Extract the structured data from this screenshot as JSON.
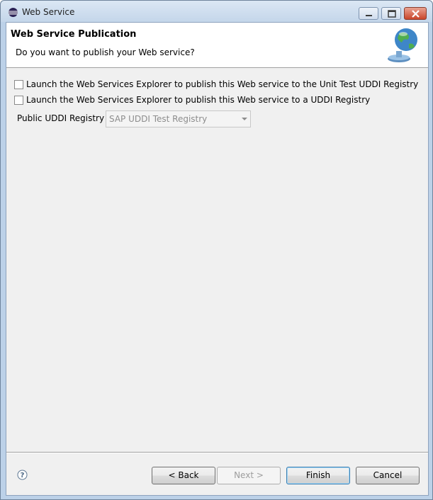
{
  "window": {
    "title": "Web Service"
  },
  "header": {
    "title": "Web Service Publication",
    "description": "Do you want to publish your Web service?"
  },
  "options": [
    {
      "label": "Launch the Web Services Explorer to publish this Web service to the Unit Test UDDI Registry",
      "checked": false
    },
    {
      "label": "Launch the Web Services Explorer to publish this Web service to a UDDI Registry",
      "checked": false
    }
  ],
  "registry": {
    "label": "Public UDDI Registry",
    "value": "SAP UDDI Test Registry",
    "enabled": false
  },
  "buttons": {
    "back": "< Back",
    "next": "Next >",
    "finish": "Finish",
    "cancel": "Cancel"
  },
  "icons": {
    "app": "eclipse-icon",
    "banner": "globe-publish-icon",
    "help": "help-icon"
  }
}
